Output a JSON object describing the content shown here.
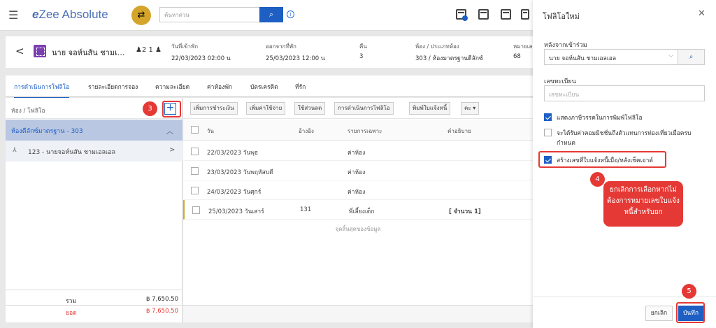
{
  "app": {
    "logo_prefix": "e",
    "logo_text": "Zee Absolute",
    "search_placeholder": "ค้นหาด่วน"
  },
  "guest": {
    "name": "นาย จอห์นสัน ชามเ...",
    "pax": "2 1",
    "checkin_label": "วันที่เข้าพัก",
    "checkin_value": "22/03/2023 02:00 น",
    "checkout_label": "ออกจากที่พัก",
    "checkout_value": "25/03/2023 12:00 น",
    "nights_label": "คืน",
    "nights_value": "3",
    "room_label": "ห้อง / ประเภทห้อง",
    "room_value": "303 / ห้องมาตรฐานดีลักซ์",
    "no_label": "หมายเล",
    "no_value": "68"
  },
  "tabs": [
    "การดำเนินการโฟลิโอ",
    "รายละเอียดการจอง",
    "ความละเอียด",
    "ค่าห้องพัก",
    "บัตรเครดิต",
    "ที่รัก"
  ],
  "left": {
    "header": "ห้อง / โฟลิโอ",
    "room_group": "ห้องดีลักซ์มาตรฐาน - 303",
    "folio_item": "123 - นายจอห์นสัน ชามเอลเอล",
    "total_label": "รวม",
    "total_value": "฿ 7,650.50",
    "balance_label": "ยอด",
    "balance_value": "฿ 7,650.50"
  },
  "actions": [
    "เพิ่มการชำระเงิน",
    "เพิ่มค่าใช้จ่าย",
    "ใช้ส่วนลด",
    "การดำเนินการโฟลิโอ",
    "พิมพ์ใบแจ้งหนี้",
    "คะ"
  ],
  "table": {
    "headers": [
      "วัน",
      "อ้างอิง",
      "รายการเฉพาะ",
      "คำอธิบาย"
    ],
    "rows": [
      [
        "22/03/2023 วันพุธ",
        "",
        "ค่าห้อง",
        ""
      ],
      [
        "23/03/2023 วันพฤหัสบดี",
        "",
        "ค่าห้อง",
        ""
      ],
      [
        "24/03/2023 วันศุกร์",
        "",
        "ค่าห้อง",
        ""
      ],
      [
        "25/03/2023 วันเสาร์",
        "131",
        "พี่เลี้ยงเด็ก",
        "[ จำนวน 1]"
      ]
    ],
    "end_msg": "จุดสิ้นสุดของข้อมูล"
  },
  "panel": {
    "title": "โฟลิโอใหม่",
    "from_label": "หลังจากเข้าร่วม",
    "from_value": "นาย จอห์นสัน ชามเอลเอล",
    "reg_label": "เลขทะเบียน",
    "reg_placeholder": "เลขทะเบียน",
    "chk1": "แสดงภาษีวรรคในการพิมพ์โฟลิโอ",
    "chk2": "จะได้รับค่าคอมมิชชั่นถึงตัวแทนการท่องเที่ยวเมื่อครบกำหนด",
    "chk3": "สร้างเลขที่ใบแจ้งหนี้เมื่อ/หลังเช็คเอาต์",
    "cancel": "ยกเลิก",
    "save": "บันทึก"
  },
  "annotations": {
    "step3": "3",
    "step4": "4",
    "step5": "5",
    "callout": "ยกเลิกการเลือกหากไม่ต้องการหมายเลขใบแจ้งหนี้สำหรับยก"
  }
}
